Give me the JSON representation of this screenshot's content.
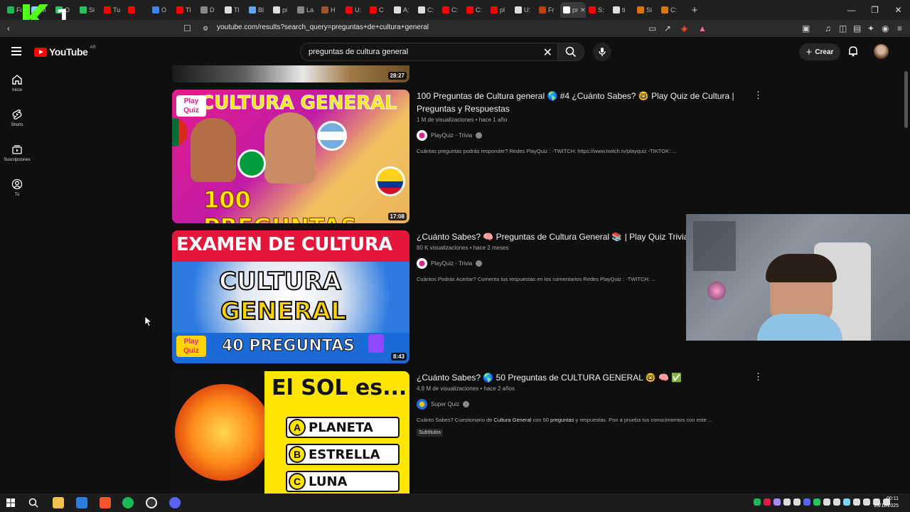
{
  "browser": {
    "url": "youtube.com/results?search_query=preguntas+de+cultura+general",
    "tabs": [
      "Fi",
      "M",
      "O",
      "Si",
      "Tu",
      "",
      "O",
      "Tl",
      "D",
      "Tl",
      "Bl",
      "pi",
      "La",
      "H",
      "U:",
      "C",
      "A:",
      "C:",
      "C:",
      "C:",
      "pl",
      "U:",
      "Fr",
      "pr",
      "S:",
      "ti",
      "Si",
      "C:"
    ],
    "stream_logo_digit": "1"
  },
  "header": {
    "brand": "YouTube",
    "country_code": "AR",
    "search_query": "preguntas de cultura general",
    "create_label": "Crear"
  },
  "sidebar": {
    "items": [
      {
        "label": "Inicio",
        "icon": "home-icon"
      },
      {
        "label": "Shorts",
        "icon": "shorts-icon"
      },
      {
        "label": "Suscripciones",
        "icon": "subscriptions-icon"
      },
      {
        "label": "Tú",
        "icon": "you-icon"
      }
    ]
  },
  "results": [
    {
      "duration": "28:27"
    },
    {
      "title": "100 Preguntas de Cultura general 🌎 #4 ¿Cuánto Sabes? 🤓 Play Quiz de Cultura | Preguntas y Respuestas",
      "views": "1 M de visualizaciones",
      "age": "hace 1 año",
      "channel": "PlayQuiz - Trivia",
      "description": "Cuántas preguntas podrás responder? Redes PlayQuiz : -TWITCH: https://www.twitch.tv/playquiz -TIKTOK: ...",
      "duration": "17:08",
      "thumb_top_text": "CULTURA GENERAL",
      "thumb_bottom_text": "100 PREGUNTAS",
      "thumb_corner": "Play Quiz"
    },
    {
      "title": "¿Cuánto Sabes? 🧠 Preguntas de Cultura General 📚 | Play Quiz Trivia",
      "views": "80 K visualizaciones",
      "age": "hace 2 meses",
      "channel": "PlayQuiz - Trivia",
      "description": "Cuántos Podrás Acertar? Comenta tus respuestas en los comentarios Redes PlayQuiz : -TWITCH: ...",
      "duration": "8:43",
      "thumb_top_text": "EXAMEN DE CULTURA",
      "thumb_mid1": "CULTURA",
      "thumb_mid2": "GENERAL",
      "thumb_bottom_text": "40 PREGUNTAS",
      "thumb_corner": "Play Quiz"
    },
    {
      "title": "¿Cuánto Sabes? 🌎 50 Preguntas de CULTURA GENERAL 🤓 🧠 ✅",
      "views": "4,8 M de visualizaciones",
      "age": "hace 2 años",
      "channel": "Super Quiz",
      "description_pre": "Cuánto Sabes? Cuestionario de ",
      "description_b1": "Cultura General",
      "description_mid": " con 50 ",
      "description_b2": "preguntas",
      "description_post": " y respuestas. Pon a prueba tus conocimientos con este ...",
      "badge": "Subtítulos",
      "thumb_title": "El SOL es...",
      "options": [
        {
          "letter": "A",
          "text": "PLANETA"
        },
        {
          "letter": "B",
          "text": "ESTRELLA"
        },
        {
          "letter": "C",
          "text": "LUNA"
        }
      ]
    }
  ],
  "taskbar": {
    "time": "00:11",
    "date": "23/11/2025"
  },
  "colors": {
    "background": "#0f0f0f",
    "brand_red": "#ff0000",
    "accent_yellow": "#ffe500",
    "accent_blue": "#1e6fe0"
  }
}
